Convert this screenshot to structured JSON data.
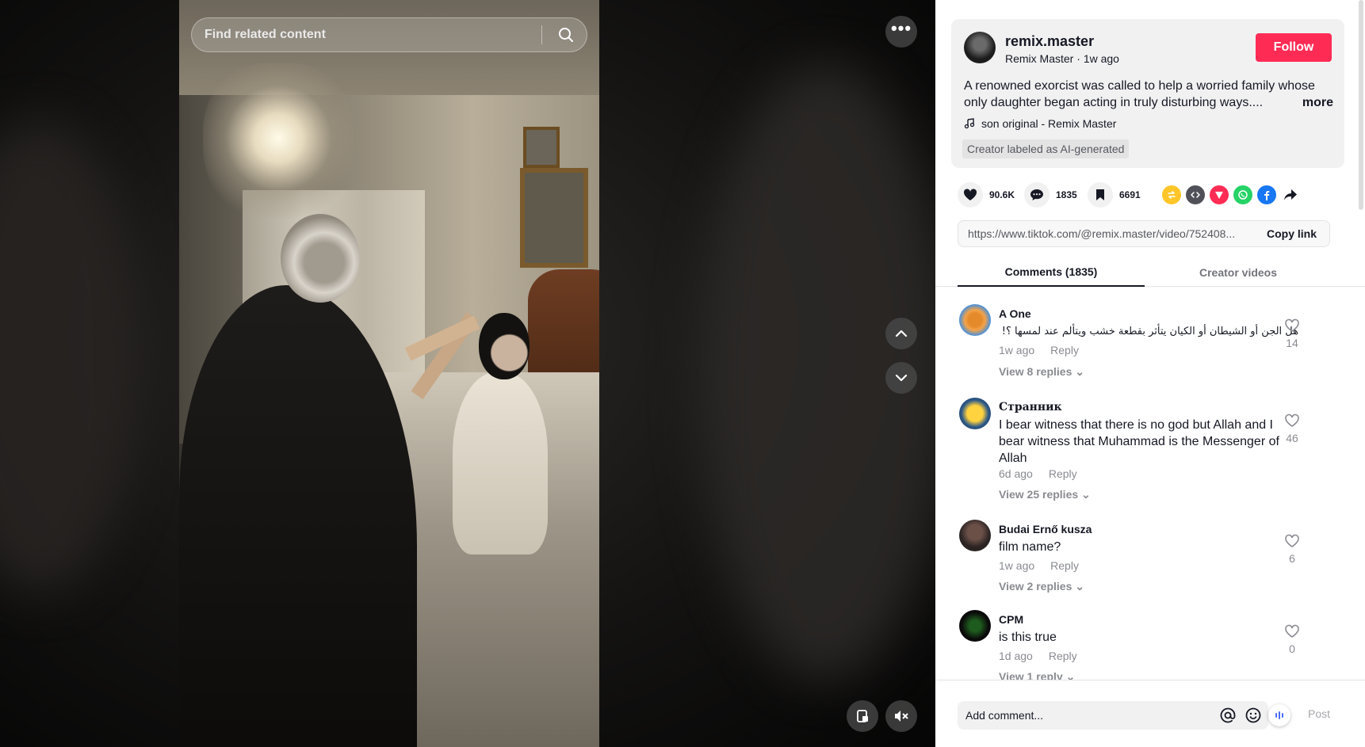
{
  "search": {
    "placeholder": "Find related content"
  },
  "post": {
    "username": "remix.master",
    "display_name": "Remix Master",
    "time": "1w ago",
    "follow_label": "Follow",
    "description": "A renowned exorcist was called to help a worried family whose only daughter began acting in truly disturbing ways....",
    "more_label": "more",
    "music": "son original - Remix Master",
    "ai_label": "Creator labeled as AI-generated"
  },
  "stats": {
    "likes": "90.6K",
    "comments": "1835",
    "saves": "6691"
  },
  "link": {
    "url": "https://www.tiktok.com/@remix.master/video/752408...",
    "copy_label": "Copy link"
  },
  "tabs": [
    {
      "label": "Comments (1835)",
      "active": true
    },
    {
      "label": "Creator videos",
      "active": false
    }
  ],
  "comments": [
    {
      "name": "A One",
      "text": "هل الجن أو الشيطان أو الكيان يتأثر بقطعة خشب ويتألم عند لمسها ؟!",
      "time": "1w ago",
      "reply": "Reply",
      "likes": "14",
      "view_replies": "View 8 replies"
    },
    {
      "name": "Странник",
      "text": "I bear witness that there is no god but Allah and I bear witness that Muhammad is the Messenger of Allah",
      "time": "6d ago",
      "reply": "Reply",
      "likes": "46",
      "view_replies": "View 25 replies"
    },
    {
      "name": "Budai Ernő kusza",
      "text": "film name?",
      "time": "1w ago",
      "reply": "Reply",
      "likes": "6",
      "view_replies": "View 2 replies"
    },
    {
      "name": "CPM",
      "text": "is this true",
      "time": "1d ago",
      "reply": "Reply",
      "likes": "0",
      "view_replies": "View 1 reply"
    }
  ],
  "comment_input": {
    "placeholder": "Add comment...",
    "post_label": "Post"
  },
  "colors": {
    "follow": "#fe2c55",
    "text": "#161823",
    "muted": "#8a8b91",
    "panel_bg": "#f1f1f2"
  },
  "icons": [
    "search-icon",
    "more-dots-icon",
    "chevron-up-icon",
    "chevron-down-icon",
    "floating-player-icon",
    "mute-icon",
    "heart-icon",
    "comment-icon",
    "bookmark-icon",
    "repost-icon",
    "embed-icon",
    "send-icon",
    "whatsapp-icon",
    "facebook-icon",
    "share-icon",
    "music-note-icon",
    "mention-icon",
    "emoji-icon"
  ]
}
